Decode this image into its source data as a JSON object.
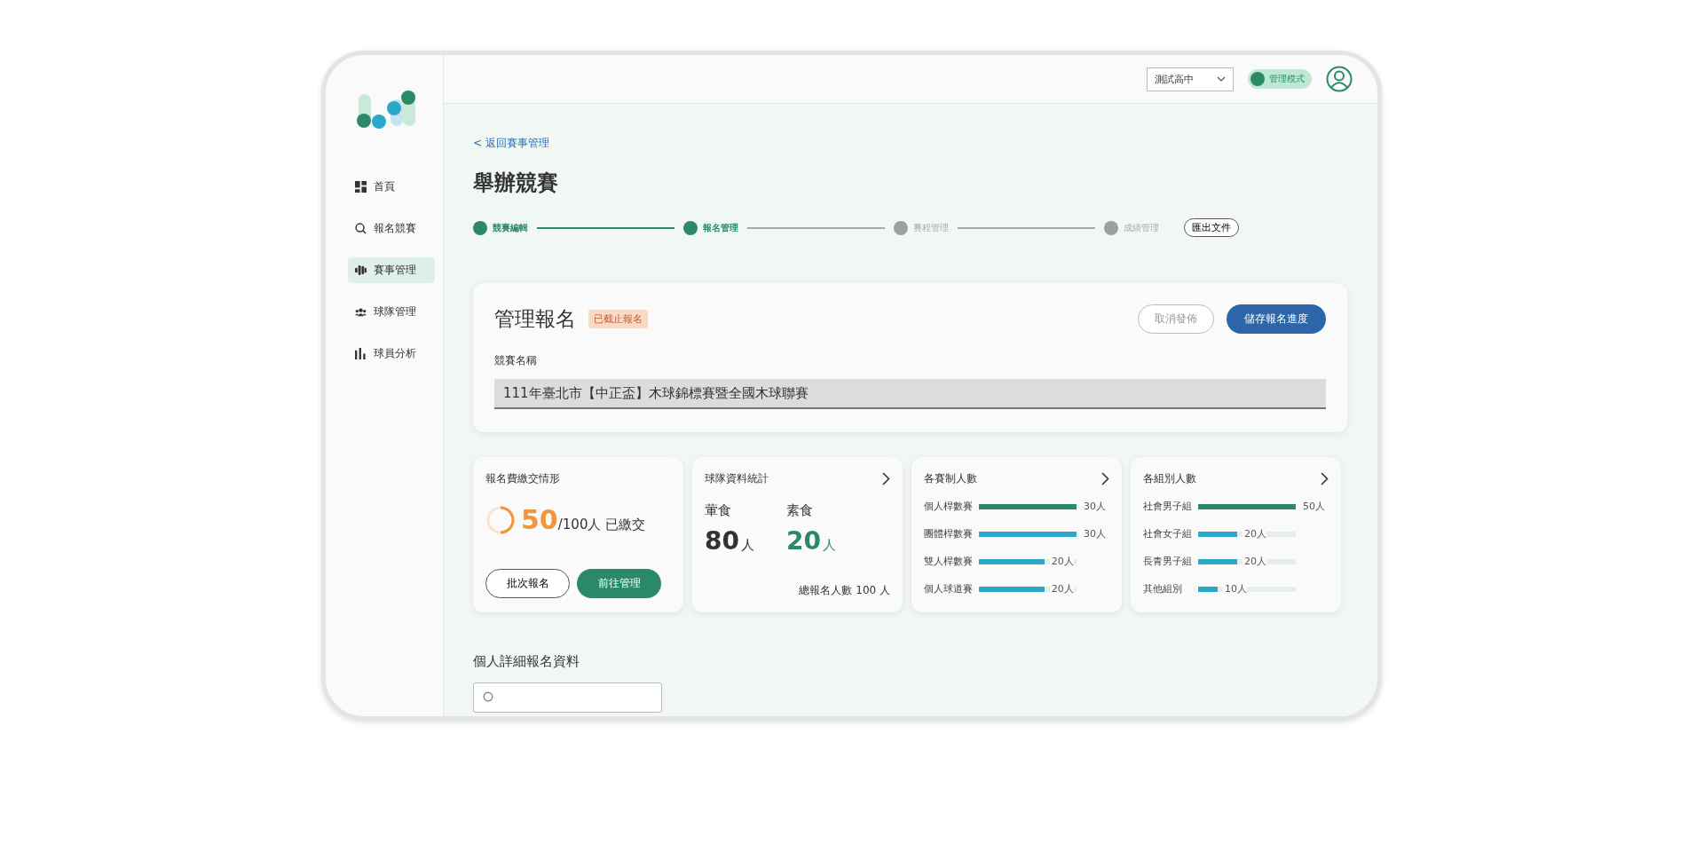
{
  "sidebar": {
    "items": [
      {
        "label": "首頁",
        "selected": false
      },
      {
        "label": "報名競賽",
        "selected": false
      },
      {
        "label": "賽事管理",
        "selected": true
      },
      {
        "label": "球隊管理",
        "selected": false
      },
      {
        "label": "球員分析",
        "selected": false
      }
    ]
  },
  "header": {
    "school_select": "測試高中",
    "mode_toggle": {
      "label": "管理模式",
      "on": true
    }
  },
  "back_link": "< 返回賽事管理",
  "page_title": "舉辦競賽",
  "steps": [
    {
      "label": "競賽編輯",
      "done": true
    },
    {
      "label": "報名管理",
      "done": true
    },
    {
      "label": "賽程管理",
      "done": false
    },
    {
      "label": "成績管理",
      "done": false
    }
  ],
  "export_button": "匯出文件",
  "manage_card": {
    "title": "管理報名",
    "status_badge": "已截止報名",
    "cancel_button": "取消發佈",
    "save_button": "儲存報名進度",
    "field_label": "競賽名稱",
    "field_value": "111年臺北市【中正盃】木球錦標賽暨全國木球聯賽"
  },
  "fee_card": {
    "title": "報名費繳交情形",
    "level": 0.5,
    "paid": "50",
    "total": "/100人 已繳交",
    "batch_button": "批次報名",
    "go_button": "前往管理"
  },
  "team_card": {
    "title": "球隊資料統計",
    "meals": [
      {
        "label": "葷食",
        "count": "80",
        "unit": "人",
        "kind": "meat"
      },
      {
        "label": "素食",
        "count": "20",
        "unit": "人",
        "kind": "veg"
      }
    ],
    "total": "總報名人數 100 人"
  },
  "bar_cards": [
    {
      "title": "各賽制人數",
      "rows": [
        {
          "label": "個人桿數賽",
          "level": 1.0,
          "value": "30人",
          "color": "#2a8a68"
        },
        {
          "label": "團體桿數賽",
          "level": 1.0,
          "value": "30人",
          "color": "#2ba8c8"
        },
        {
          "label": "雙人桿數賽",
          "level": 0.67,
          "value": "20人",
          "color": "#2ba8c8"
        },
        {
          "label": "個人球道賽",
          "level": 0.67,
          "value": "20人",
          "color": "#2ba8c8"
        }
      ]
    },
    {
      "title": "各組別人數",
      "rows": [
        {
          "label": "社會男子組",
          "level": 1.0,
          "value": "50人",
          "color": "#2a8a68"
        },
        {
          "label": "社會女子組",
          "level": 0.4,
          "value": "20人",
          "color": "#2ba8c8"
        },
        {
          "label": "長青男子組",
          "level": 0.4,
          "value": "20人",
          "color": "#2ba8c8"
        },
        {
          "label": "其他組別",
          "level": 0.2,
          "value": "10人",
          "color": "#2ba8c8"
        }
      ]
    }
  ],
  "detail_section": {
    "title": "個人詳細報名資料"
  }
}
